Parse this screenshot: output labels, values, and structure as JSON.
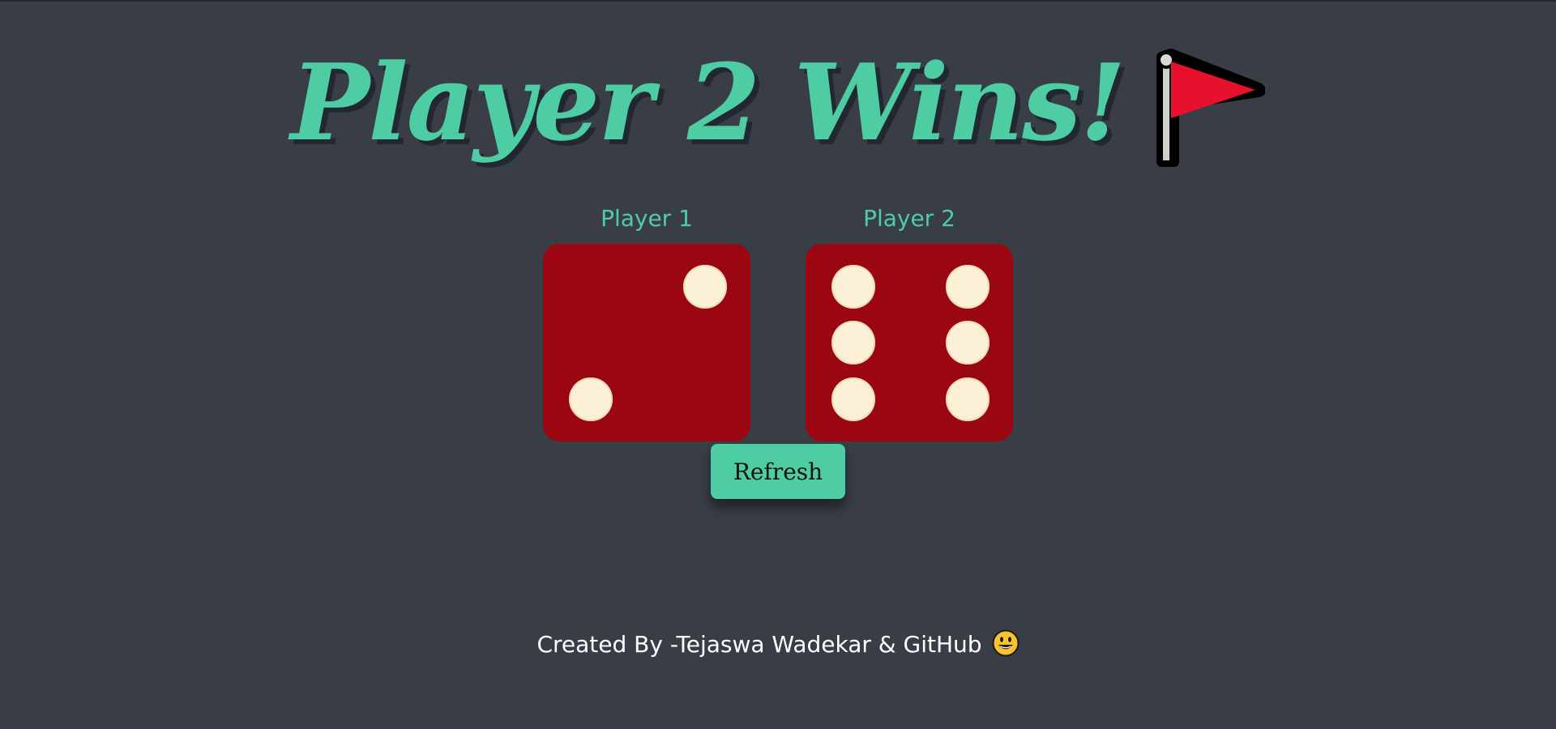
{
  "title": {
    "text": "Player 2 Wins!",
    "emoji": "red-flag-icon"
  },
  "players": [
    {
      "label": "Player 1",
      "die_value": 2
    },
    {
      "label": "Player 2",
      "die_value": 6
    }
  ],
  "refresh_button": {
    "label": "Refresh"
  },
  "footer": {
    "text": "Created By -Tejaswa Wadekar & GitHub",
    "emoji": "grinning-face-icon"
  },
  "colors": {
    "background": "#393e46",
    "accent": "#4ecca3",
    "die": "#9a0710",
    "pip": "#fbf0d6",
    "text_shadow": "#222831",
    "footer_text": "#ffffff"
  }
}
